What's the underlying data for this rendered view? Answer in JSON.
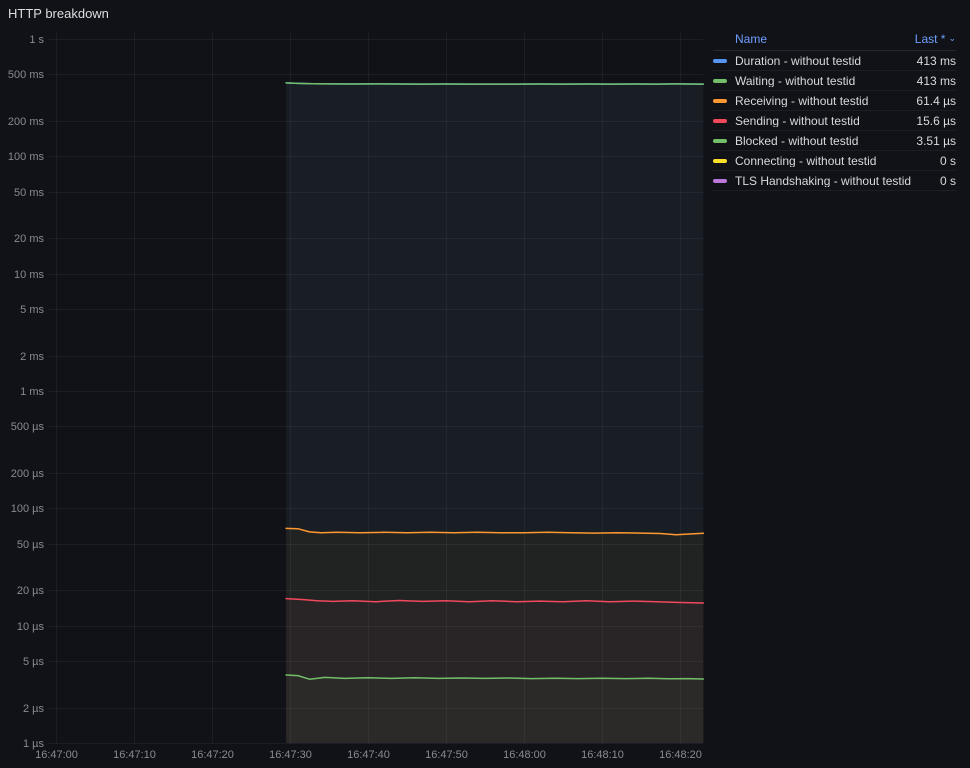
{
  "panel": {
    "title": "HTTP breakdown"
  },
  "legend": {
    "header": {
      "name": "Name",
      "last": "Last *",
      "sort_icon": "⌄"
    },
    "rows": [
      {
        "label": "Duration - without testid",
        "value": "413 ms",
        "color": "#5794F2"
      },
      {
        "label": "Waiting - without testid",
        "value": "413 ms",
        "color": "#73BF69"
      },
      {
        "label": "Receiving - without testid",
        "value": "61.4 µs",
        "color": "#FF9830"
      },
      {
        "label": "Sending - without testid",
        "value": "15.6 µs",
        "color": "#F2495C"
      },
      {
        "label": "Blocked - without testid",
        "value": "3.51 µs",
        "color": "#73BF69"
      },
      {
        "label": "Connecting - without testid",
        "value": "0 s",
        "color": "#FADE2A"
      },
      {
        "label": "TLS Handshaking - without testid",
        "value": "0 s",
        "color": "#B877D9"
      }
    ]
  },
  "chart_data": {
    "type": "line",
    "title": "HTTP breakdown",
    "y_axis": {
      "scale": "log",
      "unit": "seconds",
      "range": [
        1e-06,
        1
      ],
      "ticks": [
        {
          "v": 1,
          "label": "1 s"
        },
        {
          "v": 0.5,
          "label": "500 ms"
        },
        {
          "v": 0.2,
          "label": "200 ms"
        },
        {
          "v": 0.1,
          "label": "100 ms"
        },
        {
          "v": 0.05,
          "label": "50 ms"
        },
        {
          "v": 0.02,
          "label": "20 ms"
        },
        {
          "v": 0.01,
          "label": "10 ms"
        },
        {
          "v": 0.005,
          "label": "5 ms"
        },
        {
          "v": 0.002,
          "label": "2 ms"
        },
        {
          "v": 0.001,
          "label": "1 ms"
        },
        {
          "v": 0.0005,
          "label": "500 µs"
        },
        {
          "v": 0.0002,
          "label": "200 µs"
        },
        {
          "v": 0.0001,
          "label": "100 µs"
        },
        {
          "v": 5e-05,
          "label": "50 µs"
        },
        {
          "v": 2e-05,
          "label": "20 µs"
        },
        {
          "v": 1e-05,
          "label": "10 µs"
        },
        {
          "v": 5e-06,
          "label": "5 µs"
        },
        {
          "v": 2e-06,
          "label": "2 µs"
        },
        {
          "v": 1e-06,
          "label": "1 µs"
        }
      ]
    },
    "x_axis": {
      "unit": "time",
      "ticks": [
        {
          "t": 0,
          "label": "16:47:00"
        },
        {
          "t": 10,
          "label": "16:47:10"
        },
        {
          "t": 20,
          "label": "16:47:20"
        },
        {
          "t": 30,
          "label": "16:47:30"
        },
        {
          "t": 40,
          "label": "16:47:40"
        },
        {
          "t": 50,
          "label": "16:47:50"
        },
        {
          "t": 60,
          "label": "16:48:00"
        },
        {
          "t": 70,
          "label": "16:48:10"
        },
        {
          "t": 80,
          "label": "16:48:20"
        }
      ]
    },
    "series": [
      {
        "name": "Duration - without testid",
        "color": "#5794F2",
        "last": "413 ms",
        "points": [
          [
            29.5,
            0.4225
          ],
          [
            31,
            0.4185
          ],
          [
            33,
            0.4155
          ],
          [
            35,
            0.414
          ],
          [
            38,
            0.4135
          ],
          [
            41,
            0.414
          ],
          [
            44,
            0.4135
          ],
          [
            47,
            0.413
          ],
          [
            50,
            0.4135
          ],
          [
            53,
            0.413
          ],
          [
            56,
            0.4125
          ],
          [
            59,
            0.413
          ],
          [
            62,
            0.4135
          ],
          [
            65,
            0.413
          ],
          [
            68,
            0.4135
          ],
          [
            71,
            0.413
          ],
          [
            74,
            0.4135
          ],
          [
            77,
            0.413
          ],
          [
            79.5,
            0.4145
          ],
          [
            81,
            0.4135
          ],
          [
            83,
            0.413
          ]
        ]
      },
      {
        "name": "Waiting - without testid",
        "color": "#73BF69",
        "last": "413 ms",
        "points": [
          [
            29.5,
            0.4225
          ],
          [
            31,
            0.4185
          ],
          [
            33,
            0.4155
          ],
          [
            35,
            0.414
          ],
          [
            38,
            0.4135
          ],
          [
            41,
            0.414
          ],
          [
            44,
            0.4135
          ],
          [
            47,
            0.413
          ],
          [
            50,
            0.4135
          ],
          [
            53,
            0.413
          ],
          [
            56,
            0.4125
          ],
          [
            59,
            0.413
          ],
          [
            62,
            0.4135
          ],
          [
            65,
            0.413
          ],
          [
            68,
            0.4135
          ],
          [
            71,
            0.413
          ],
          [
            74,
            0.4135
          ],
          [
            77,
            0.413
          ],
          [
            79.5,
            0.4145
          ],
          [
            81,
            0.4135
          ],
          [
            83,
            0.413
          ]
        ]
      },
      {
        "name": "Receiving - without testid",
        "color": "#FF9830",
        "last": "61.4 µs",
        "points": [
          [
            29.5,
            6.75e-05
          ],
          [
            31,
            6.7e-05
          ],
          [
            32.5,
            6.3e-05
          ],
          [
            34,
            6.2e-05
          ],
          [
            36,
            6.25e-05
          ],
          [
            39,
            6.2e-05
          ],
          [
            42,
            6.25e-05
          ],
          [
            45,
            6.2e-05
          ],
          [
            48,
            6.25e-05
          ],
          [
            51,
            6.2e-05
          ],
          [
            54,
            6.25e-05
          ],
          [
            57,
            6.2e-05
          ],
          [
            60,
            6.2e-05
          ],
          [
            63,
            6.25e-05
          ],
          [
            66,
            6.2e-05
          ],
          [
            69,
            6.15e-05
          ],
          [
            72,
            6.2e-05
          ],
          [
            75,
            6.15e-05
          ],
          [
            77.5,
            6.1e-05
          ],
          [
            79.5,
            5.95e-05
          ],
          [
            81.5,
            6.05e-05
          ],
          [
            83,
            6.14e-05
          ]
        ]
      },
      {
        "name": "Sending - without testid",
        "color": "#F2495C",
        "last": "15.6 µs",
        "points": [
          [
            29.5,
            1.7e-05
          ],
          [
            31.5,
            1.67e-05
          ],
          [
            33.5,
            1.63e-05
          ],
          [
            35.5,
            1.61e-05
          ],
          [
            38,
            1.63e-05
          ],
          [
            41,
            1.6e-05
          ],
          [
            44,
            1.64e-05
          ],
          [
            47,
            1.61e-05
          ],
          [
            50,
            1.63e-05
          ],
          [
            53,
            1.6e-05
          ],
          [
            56,
            1.63e-05
          ],
          [
            59,
            1.6e-05
          ],
          [
            62,
            1.62e-05
          ],
          [
            65,
            1.6e-05
          ],
          [
            68,
            1.63e-05
          ],
          [
            71,
            1.6e-05
          ],
          [
            74,
            1.62e-05
          ],
          [
            77,
            1.6e-05
          ],
          [
            79.5,
            1.58e-05
          ],
          [
            81.5,
            1.57e-05
          ],
          [
            83,
            1.56e-05
          ]
        ]
      },
      {
        "name": "Blocked - without testid",
        "color": "#73BF69",
        "last": "3.51 µs",
        "points": [
          [
            29.5,
            3.8e-06
          ],
          [
            31,
            3.75e-06
          ],
          [
            32.5,
            3.5e-06
          ],
          [
            34.5,
            3.62e-06
          ],
          [
            37,
            3.55e-06
          ],
          [
            40,
            3.6e-06
          ],
          [
            43,
            3.55e-06
          ],
          [
            46,
            3.6e-06
          ],
          [
            49,
            3.55e-06
          ],
          [
            52,
            3.58e-06
          ],
          [
            55,
            3.55e-06
          ],
          [
            58,
            3.58e-06
          ],
          [
            61,
            3.54e-06
          ],
          [
            64,
            3.57e-06
          ],
          [
            67,
            3.54e-06
          ],
          [
            70,
            3.57e-06
          ],
          [
            73,
            3.54e-06
          ],
          [
            76,
            3.56e-06
          ],
          [
            78.5,
            3.53e-06
          ],
          [
            81,
            3.54e-06
          ],
          [
            83,
            3.51e-06
          ]
        ]
      },
      {
        "name": "Connecting - without testid",
        "color": "#FADE2A",
        "last": "0 s",
        "points": []
      },
      {
        "name": "TLS Handshaking - without testid",
        "color": "#B877D9",
        "last": "0 s",
        "points": []
      }
    ]
  }
}
